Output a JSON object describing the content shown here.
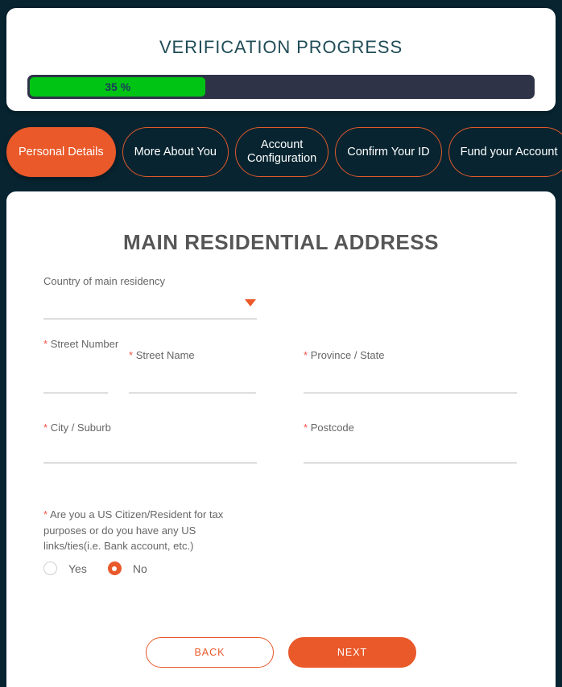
{
  "progress": {
    "title": "VERIFICATION PROGRESS",
    "percent_label": "35 %",
    "percent_value": 35,
    "fill_color": "#00c413",
    "track_color": "#2e3348"
  },
  "tabs": [
    {
      "label": "Personal Details",
      "active": true
    },
    {
      "label": "More About You",
      "active": false
    },
    {
      "label": "Account\nConfiguration",
      "active": false
    },
    {
      "label": "Confirm Your ID",
      "active": false
    },
    {
      "label": "Fund your Account",
      "active": false
    }
  ],
  "form": {
    "title": "MAIN RESIDENTIAL ADDRESS",
    "country": {
      "label": "Country of main residency",
      "value": "",
      "caret_icon": "caret-down-icon"
    },
    "fields": [
      {
        "name": "street-number",
        "required": true,
        "label": "Street Number",
        "value": ""
      },
      {
        "name": "street-name",
        "required": true,
        "label": "Street Name",
        "value": ""
      },
      {
        "name": "province-state",
        "required": true,
        "label": "Province / State",
        "value": ""
      },
      {
        "name": "city-suburb",
        "required": true,
        "label": "City / Suburb",
        "value": ""
      },
      {
        "name": "postcode",
        "required": true,
        "label": "Postcode",
        "value": ""
      }
    ],
    "us_citizen": {
      "required": true,
      "question": "Are you a US Citizen/Resident for tax purposes or do you have any US links/ties(i.e. Bank account, etc.)",
      "options": [
        {
          "label": "Yes",
          "selected": false
        },
        {
          "label": "No",
          "selected": true
        }
      ]
    },
    "buttons": {
      "back": "BACK",
      "next": "NEXT"
    }
  },
  "colors": {
    "background": "#072430",
    "accent": "#e9592a",
    "required": "#f0534a",
    "title": "#1f4c57"
  }
}
